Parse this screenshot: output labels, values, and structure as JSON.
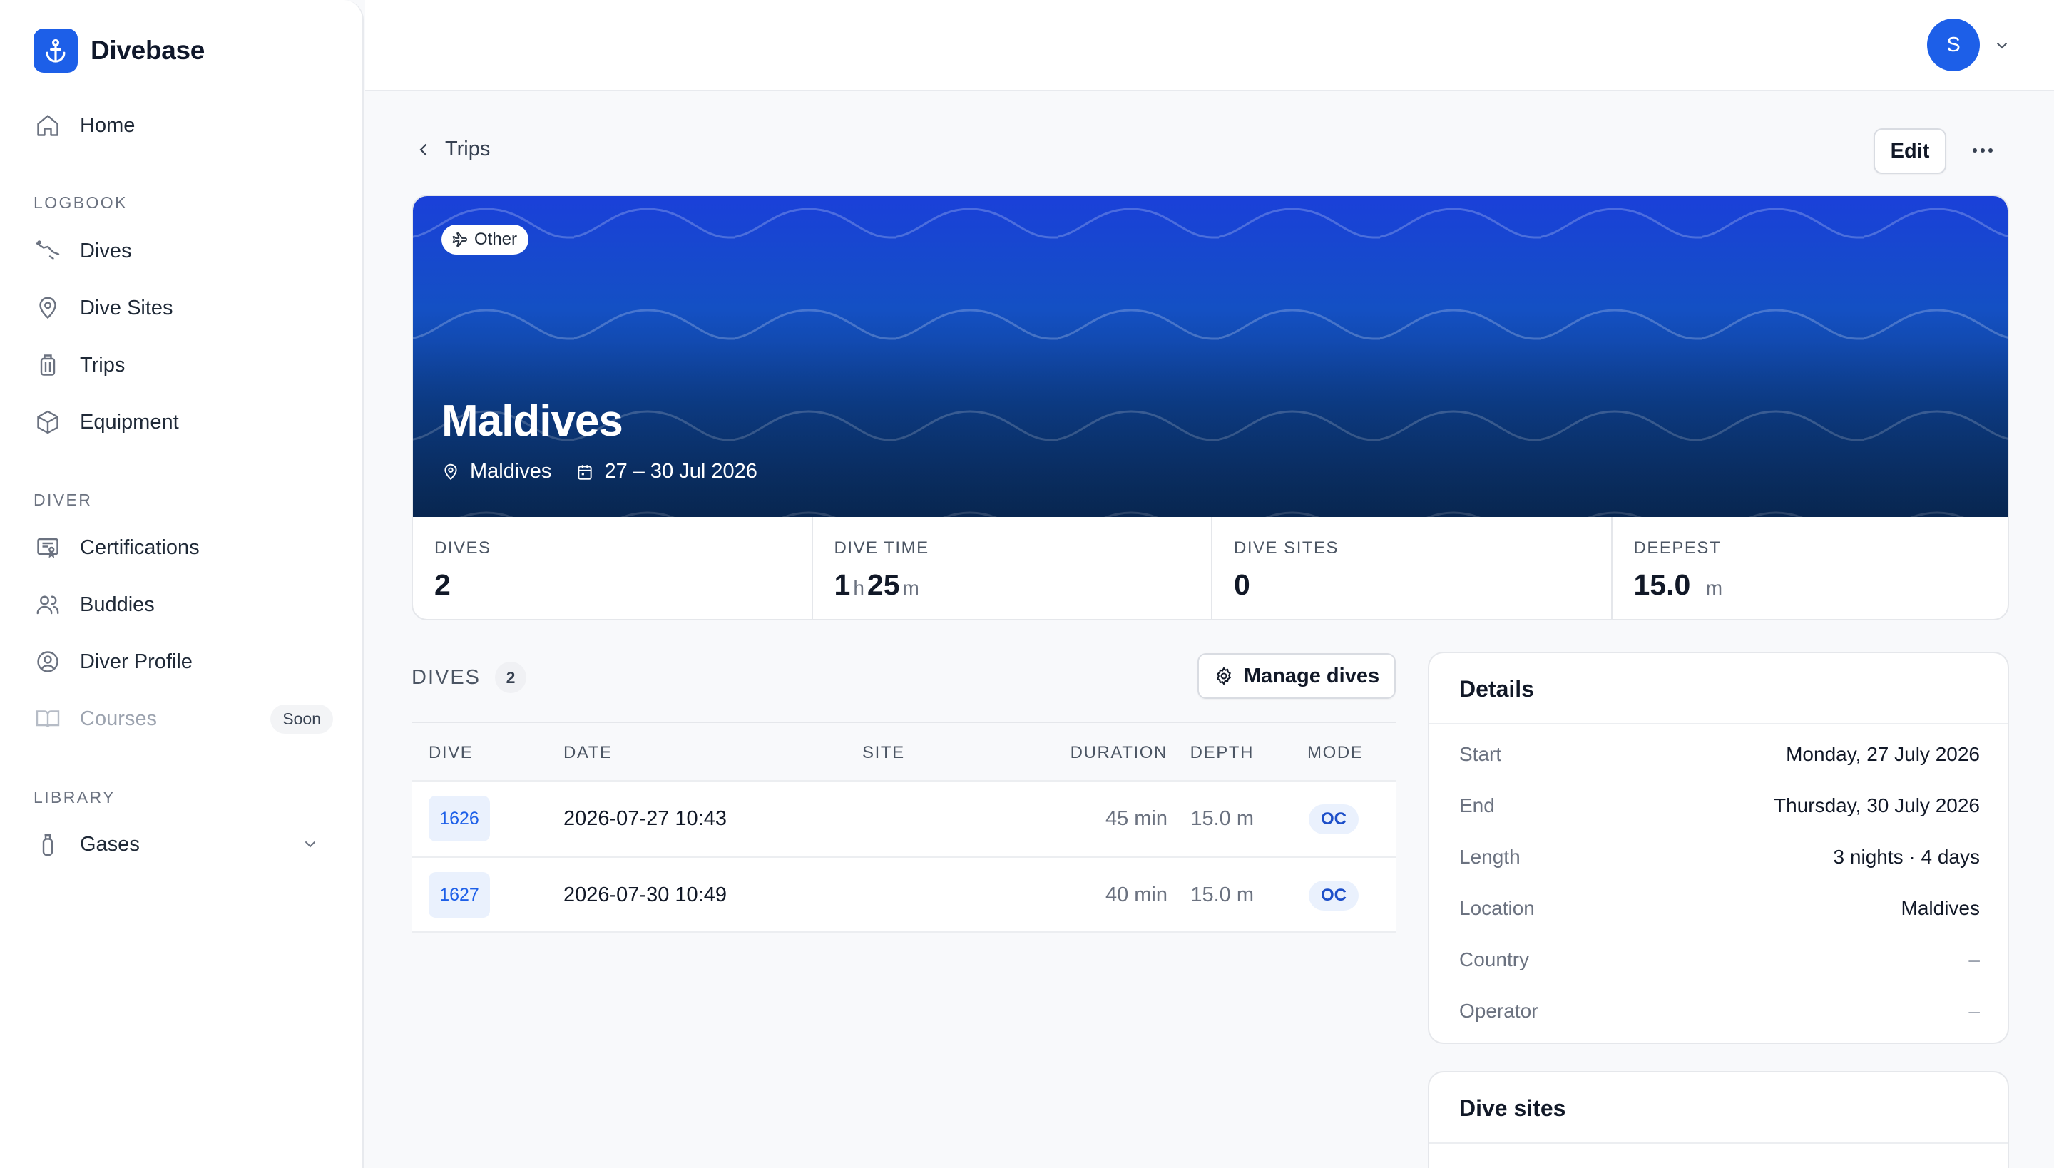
{
  "app": {
    "name": "Divebase"
  },
  "sidebar": {
    "home": "Home",
    "sections": {
      "logbook": "LOGBOOK",
      "diver": "DIVER",
      "library": "LIBRARY"
    },
    "logbook": [
      "Dives",
      "Dive Sites",
      "Trips",
      "Equipment"
    ],
    "diver": [
      "Certifications",
      "Buddies",
      "Diver Profile"
    ],
    "courses": {
      "label": "Courses",
      "badge": "Soon"
    },
    "library": {
      "gases": "Gases"
    }
  },
  "user": {
    "initial": "S"
  },
  "header": {
    "back_label": "Trips",
    "edit_label": "Edit"
  },
  "trip": {
    "category": "Other",
    "title": "Maldives",
    "location": "Maldives",
    "dates": "27 – 30 Jul 2026"
  },
  "stats": {
    "dives": {
      "label": "DIVES",
      "value": "2"
    },
    "dive_time": {
      "label": "DIVE TIME",
      "hours": "1",
      "h_unit": "h",
      "minutes": "25",
      "m_unit": "m"
    },
    "dive_sites": {
      "label": "DIVE SITES",
      "value": "0"
    },
    "deepest": {
      "label": "DEEPEST",
      "value": "15.0",
      "unit": "m"
    }
  },
  "dives": {
    "title": "DIVES",
    "count": "2",
    "manage_label": "Manage dives",
    "columns": [
      "DIVE",
      "DATE",
      "SITE",
      "DURATION",
      "DEPTH",
      "MODE"
    ],
    "rows": [
      {
        "num": "1626",
        "date": "2026-07-27 10:43",
        "site": "",
        "duration": "45 min",
        "depth": "15.0 m",
        "mode": "OC"
      },
      {
        "num": "1627",
        "date": "2026-07-30 10:49",
        "site": "",
        "duration": "40 min",
        "depth": "15.0 m",
        "mode": "OC"
      }
    ]
  },
  "details": {
    "title": "Details",
    "rows": [
      {
        "label": "Start",
        "value": "Monday, 27 July 2026"
      },
      {
        "label": "End",
        "value": "Thursday, 30 July 2026"
      },
      {
        "label": "Length",
        "value": "3 nights · 4 days"
      },
      {
        "label": "Location",
        "value": "Maldives"
      },
      {
        "label": "Country",
        "value": "–"
      },
      {
        "label": "Operator",
        "value": "–"
      }
    ]
  },
  "dive_sites_card": {
    "title": "Dive sites"
  },
  "colors": {
    "accent": "#1d5fe8",
    "hero_top": "#1a40d9",
    "hero_bottom": "#0a3060"
  },
  "icons": {
    "brand": "anchor-icon",
    "home": "home-icon",
    "dives": "dive-icon",
    "dive_sites": "map-pin-icon",
    "trips": "luggage-icon",
    "equipment": "box-icon",
    "certifications": "certificate-icon",
    "buddies": "users-icon",
    "diver_profile": "user-circle-icon",
    "courses": "book-icon",
    "gases": "tank-icon",
    "category": "plane-icon",
    "settings": "gear-icon"
  }
}
